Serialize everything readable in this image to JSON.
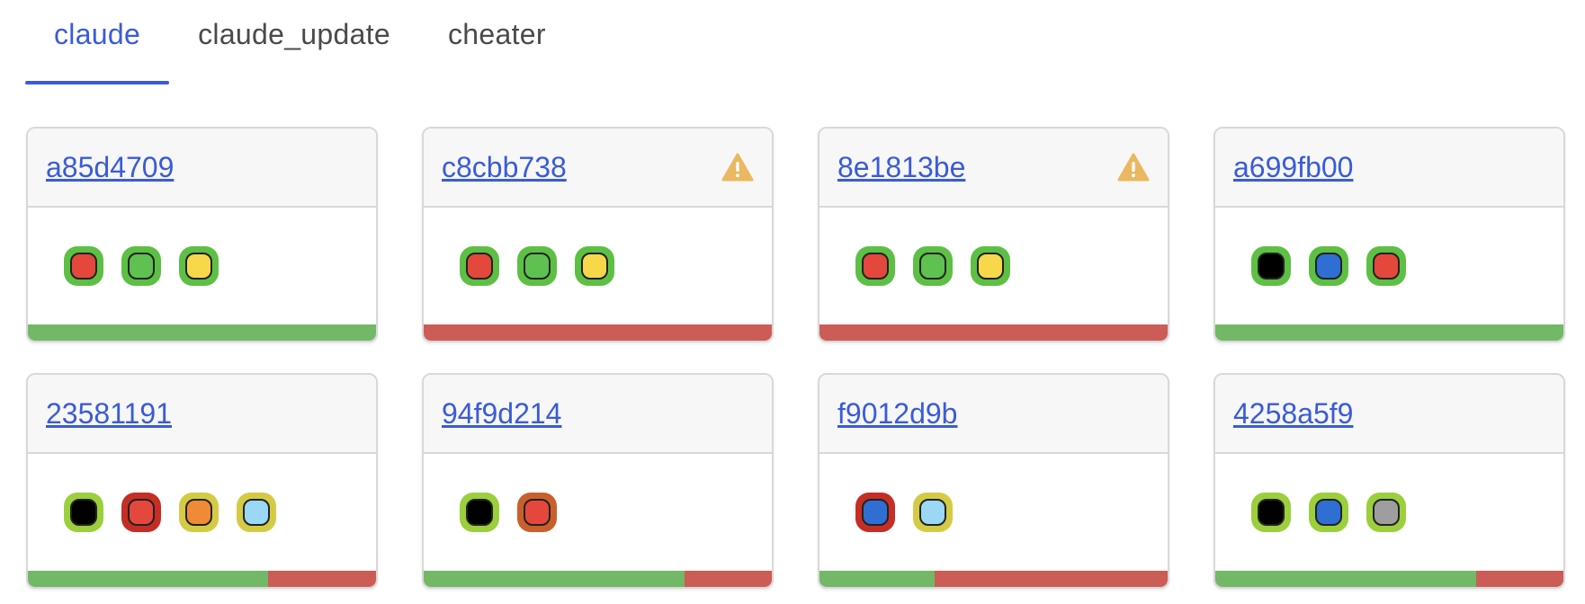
{
  "tabs": [
    {
      "label": "claude",
      "active": true
    },
    {
      "label": "claude_update",
      "active": false
    },
    {
      "label": "cheater",
      "active": false
    }
  ],
  "colors": {
    "pass": "#72b866",
    "fail": "#cc5c56",
    "warning": "#e9b860",
    "link": "#3a5bd9"
  },
  "cards": [
    {
      "id": "a85d4709",
      "warning": false,
      "dots": [
        {
          "ring": "#5dc044",
          "fill": "#e4483c"
        },
        {
          "ring": "#5dc044",
          "fill": "#5fc14f"
        },
        {
          "ring": "#5dc044",
          "fill": "#f6d84a"
        }
      ],
      "pass_fraction": 1.0
    },
    {
      "id": "c8cbb738",
      "warning": true,
      "dots": [
        {
          "ring": "#5dc044",
          "fill": "#e4483c"
        },
        {
          "ring": "#5dc044",
          "fill": "#5fc14f"
        },
        {
          "ring": "#5dc044",
          "fill": "#f6d84a"
        }
      ],
      "pass_fraction": 0.0
    },
    {
      "id": "8e1813be",
      "warning": true,
      "dots": [
        {
          "ring": "#5dc044",
          "fill": "#e4483c"
        },
        {
          "ring": "#5dc044",
          "fill": "#5fc14f"
        },
        {
          "ring": "#5dc044",
          "fill": "#f6d84a"
        }
      ],
      "pass_fraction": 0.0
    },
    {
      "id": "a699fb00",
      "warning": false,
      "dots": [
        {
          "ring": "#5dc044",
          "fill": "#000000"
        },
        {
          "ring": "#5dc044",
          "fill": "#2f6fd4"
        },
        {
          "ring": "#5dc044",
          "fill": "#e4483c"
        }
      ],
      "pass_fraction": 1.0
    },
    {
      "id": "23581191",
      "warning": false,
      "dots": [
        {
          "ring": "#9bcf3c",
          "fill": "#000000"
        },
        {
          "ring": "#c42e24",
          "fill": "#e4483c"
        },
        {
          "ring": "#d4cb45",
          "fill": "#ef8b36"
        },
        {
          "ring": "#d4cb45",
          "fill": "#9ad8f6"
        }
      ],
      "pass_fraction": 0.69
    },
    {
      "id": "94f9d214",
      "warning": false,
      "dots": [
        {
          "ring": "#9bcf3c",
          "fill": "#000000"
        },
        {
          "ring": "#c8602c",
          "fill": "#e4483c"
        }
      ],
      "pass_fraction": 0.75
    },
    {
      "id": "f9012d9b",
      "warning": false,
      "dots": [
        {
          "ring": "#c42e24",
          "fill": "#2f6fd4"
        },
        {
          "ring": "#d4cb45",
          "fill": "#9ad8f6"
        }
      ],
      "pass_fraction": 0.33
    },
    {
      "id": "4258a5f9",
      "warning": false,
      "dots": [
        {
          "ring": "#9bcf3c",
          "fill": "#000000"
        },
        {
          "ring": "#9bcf3c",
          "fill": "#2f6fd4"
        },
        {
          "ring": "#9bcf3c",
          "fill": "#9e9e9e"
        }
      ],
      "pass_fraction": 0.75
    }
  ]
}
